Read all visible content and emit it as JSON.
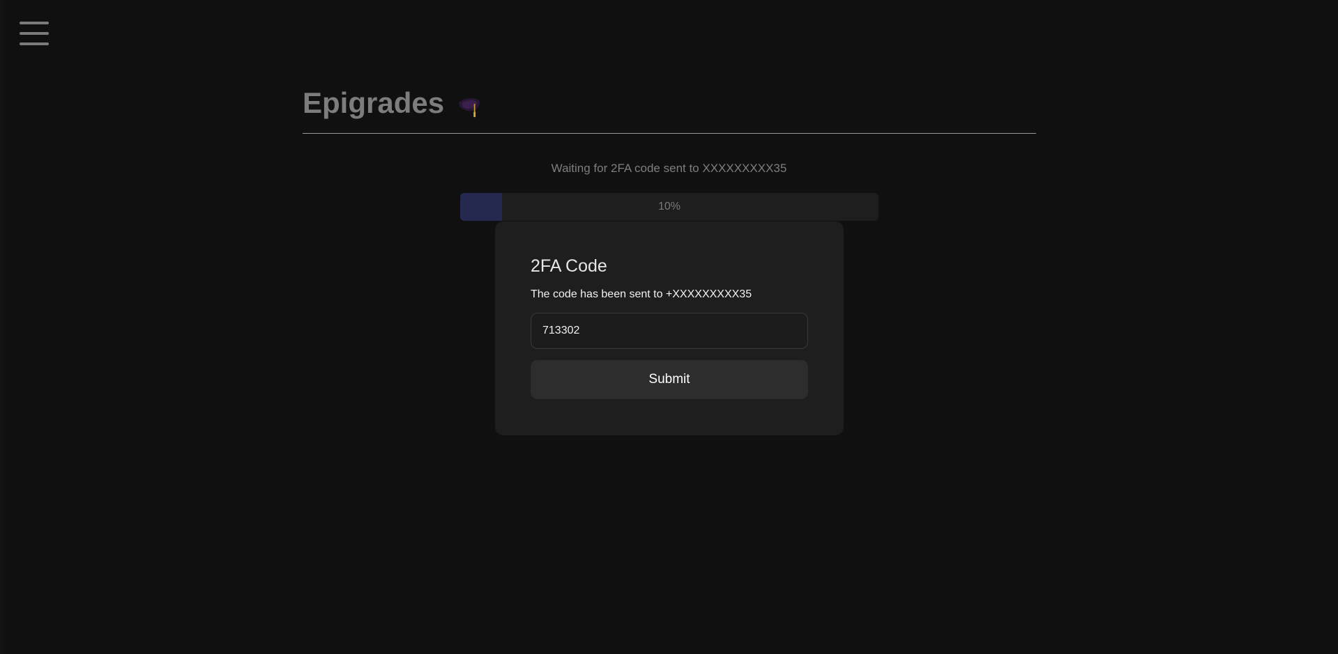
{
  "menu": {
    "icon": "hamburger-menu-icon"
  },
  "header": {
    "title": "Epigrades",
    "icon": "graduation-cap-icon"
  },
  "status": {
    "text": "Waiting for 2FA code sent to XXXXXXXXX35"
  },
  "progress": {
    "value": 0.1,
    "label": "10%",
    "fill_color": "#25284f"
  },
  "modal": {
    "title": "2FA Code",
    "message": "The code has been sent to +XXXXXXXXX35",
    "code_value": "713302",
    "submit_label": "Submit"
  }
}
